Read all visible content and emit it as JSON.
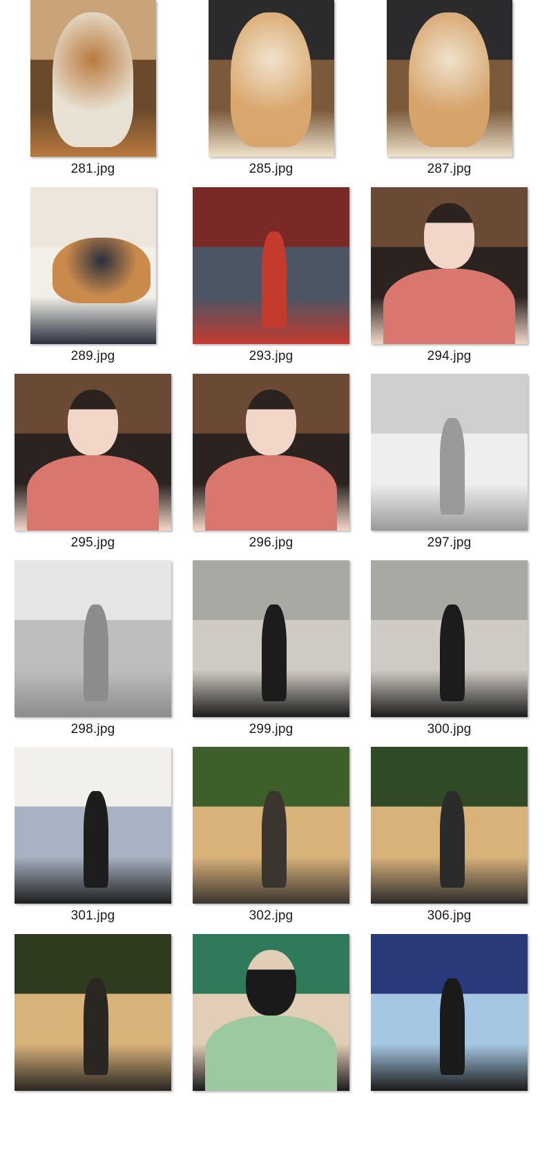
{
  "window": {
    "view": "file-thumbnail-grid"
  },
  "files": [
    {
      "name": "281.jpg",
      "icon": "image-thumbnail-icon",
      "palette": [
        "#c9a37a",
        "#e9e2d4",
        "#b97a3e",
        "#6b4a2b"
      ],
      "orient": "portrait",
      "scene": "shiba-room"
    },
    {
      "name": "285.jpg",
      "icon": "image-thumbnail-icon",
      "palette": [
        "#2b2b2e",
        "#d9a76e",
        "#f1e3cc",
        "#7a5a3a"
      ],
      "orient": "portrait",
      "scene": "shiba-closeup"
    },
    {
      "name": "287.jpg",
      "icon": "image-thumbnail-icon",
      "palette": [
        "#2b2b2e",
        "#d6a36b",
        "#efe2cb",
        "#7a5a3a"
      ],
      "orient": "portrait",
      "scene": "shiba-closeup"
    },
    {
      "name": "289.jpg",
      "icon": "image-thumbnail-icon",
      "palette": [
        "#ece6dc",
        "#c98a4c",
        "#2a2f3c",
        "#f2efe8"
      ],
      "orient": "portrait",
      "scene": "shiba-bed"
    },
    {
      "name": "293.jpg",
      "icon": "image-thumbnail-icon",
      "palette": [
        "#7a2a26",
        "#2f5a2e",
        "#c43b2e",
        "#4c5564"
      ],
      "orient": "square",
      "scene": "christmas-tree"
    },
    {
      "name": "294.jpg",
      "icon": "image-thumbnail-icon",
      "palette": [
        "#6a4a35",
        "#d9776e",
        "#f2d6c8",
        "#2b2320"
      ],
      "orient": "square",
      "scene": "selfie-pink"
    },
    {
      "name": "295.jpg",
      "icon": "image-thumbnail-icon",
      "palette": [
        "#6a4a35",
        "#d9776e",
        "#f2d6c8",
        "#2b2320"
      ],
      "orient": "square",
      "scene": "selfie-pink"
    },
    {
      "name": "296.jpg",
      "icon": "image-thumbnail-icon",
      "palette": [
        "#6a4a35",
        "#d9776e",
        "#f2d6c8",
        "#2b2320"
      ],
      "orient": "square",
      "scene": "selfie-pink"
    },
    {
      "name": "297.jpg",
      "icon": "image-thumbnail-icon",
      "palette": [
        "#cfcfcf",
        "#2f3540",
        "#9a9a9a",
        "#eeeeee"
      ],
      "orient": "square",
      "scene": "mirror-denim"
    },
    {
      "name": "298.jpg",
      "icon": "image-thumbnail-icon",
      "palette": [
        "#e6e6e6",
        "#262a33",
        "#8c8c8c",
        "#bdbdbd"
      ],
      "orient": "square",
      "scene": "mirror-denim-full"
    },
    {
      "name": "299.jpg",
      "icon": "image-thumbnail-icon",
      "palette": [
        "#a9a9a4",
        "#4f6a3c",
        "#1c1c1c",
        "#cfcac2"
      ],
      "orient": "square",
      "scene": "glass-courtyard"
    },
    {
      "name": "300.jpg",
      "icon": "image-thumbnail-icon",
      "palette": [
        "#a9a9a4",
        "#4f6a3c",
        "#1c1c1c",
        "#cfcac2"
      ],
      "orient": "square",
      "scene": "glass-courtyard"
    },
    {
      "name": "301.jpg",
      "icon": "image-thumbnail-icon",
      "palette": [
        "#f1f0ec",
        "#8a1f2a",
        "#1d1d1d",
        "#a7b2c2"
      ],
      "orient": "square",
      "scene": "gallery-wall"
    },
    {
      "name": "302.jpg",
      "icon": "image-thumbnail-icon",
      "palette": [
        "#3f5f2a",
        "#7ea05a",
        "#3b3530",
        "#d9b27a"
      ],
      "orient": "square",
      "scene": "garden-pavilion"
    },
    {
      "name": "306.jpg",
      "icon": "image-thumbnail-icon",
      "palette": [
        "#2f4a24",
        "#5f7f3e",
        "#2b2b2b",
        "#d9b27a"
      ],
      "orient": "square",
      "scene": "forest-path"
    },
    {
      "name": "",
      "icon": "image-thumbnail-icon",
      "palette": [
        "#2d3b1e",
        "#5e6b3a",
        "#2a2622",
        "#d9b27a"
      ],
      "orient": "square",
      "scene": "old-house"
    },
    {
      "name": "",
      "icon": "image-thumbnail-icon",
      "palette": [
        "#2f7a5a",
        "#9cc9a0",
        "#1a1a1a",
        "#e2cdb6"
      ],
      "orient": "square",
      "scene": "green-mural"
    },
    {
      "name": "",
      "icon": "image-thumbnail-icon",
      "palette": [
        "#283a7a",
        "#e0842c",
        "#1a1a1a",
        "#a6c7e3"
      ],
      "orient": "square",
      "scene": "painting-gallery"
    }
  ]
}
